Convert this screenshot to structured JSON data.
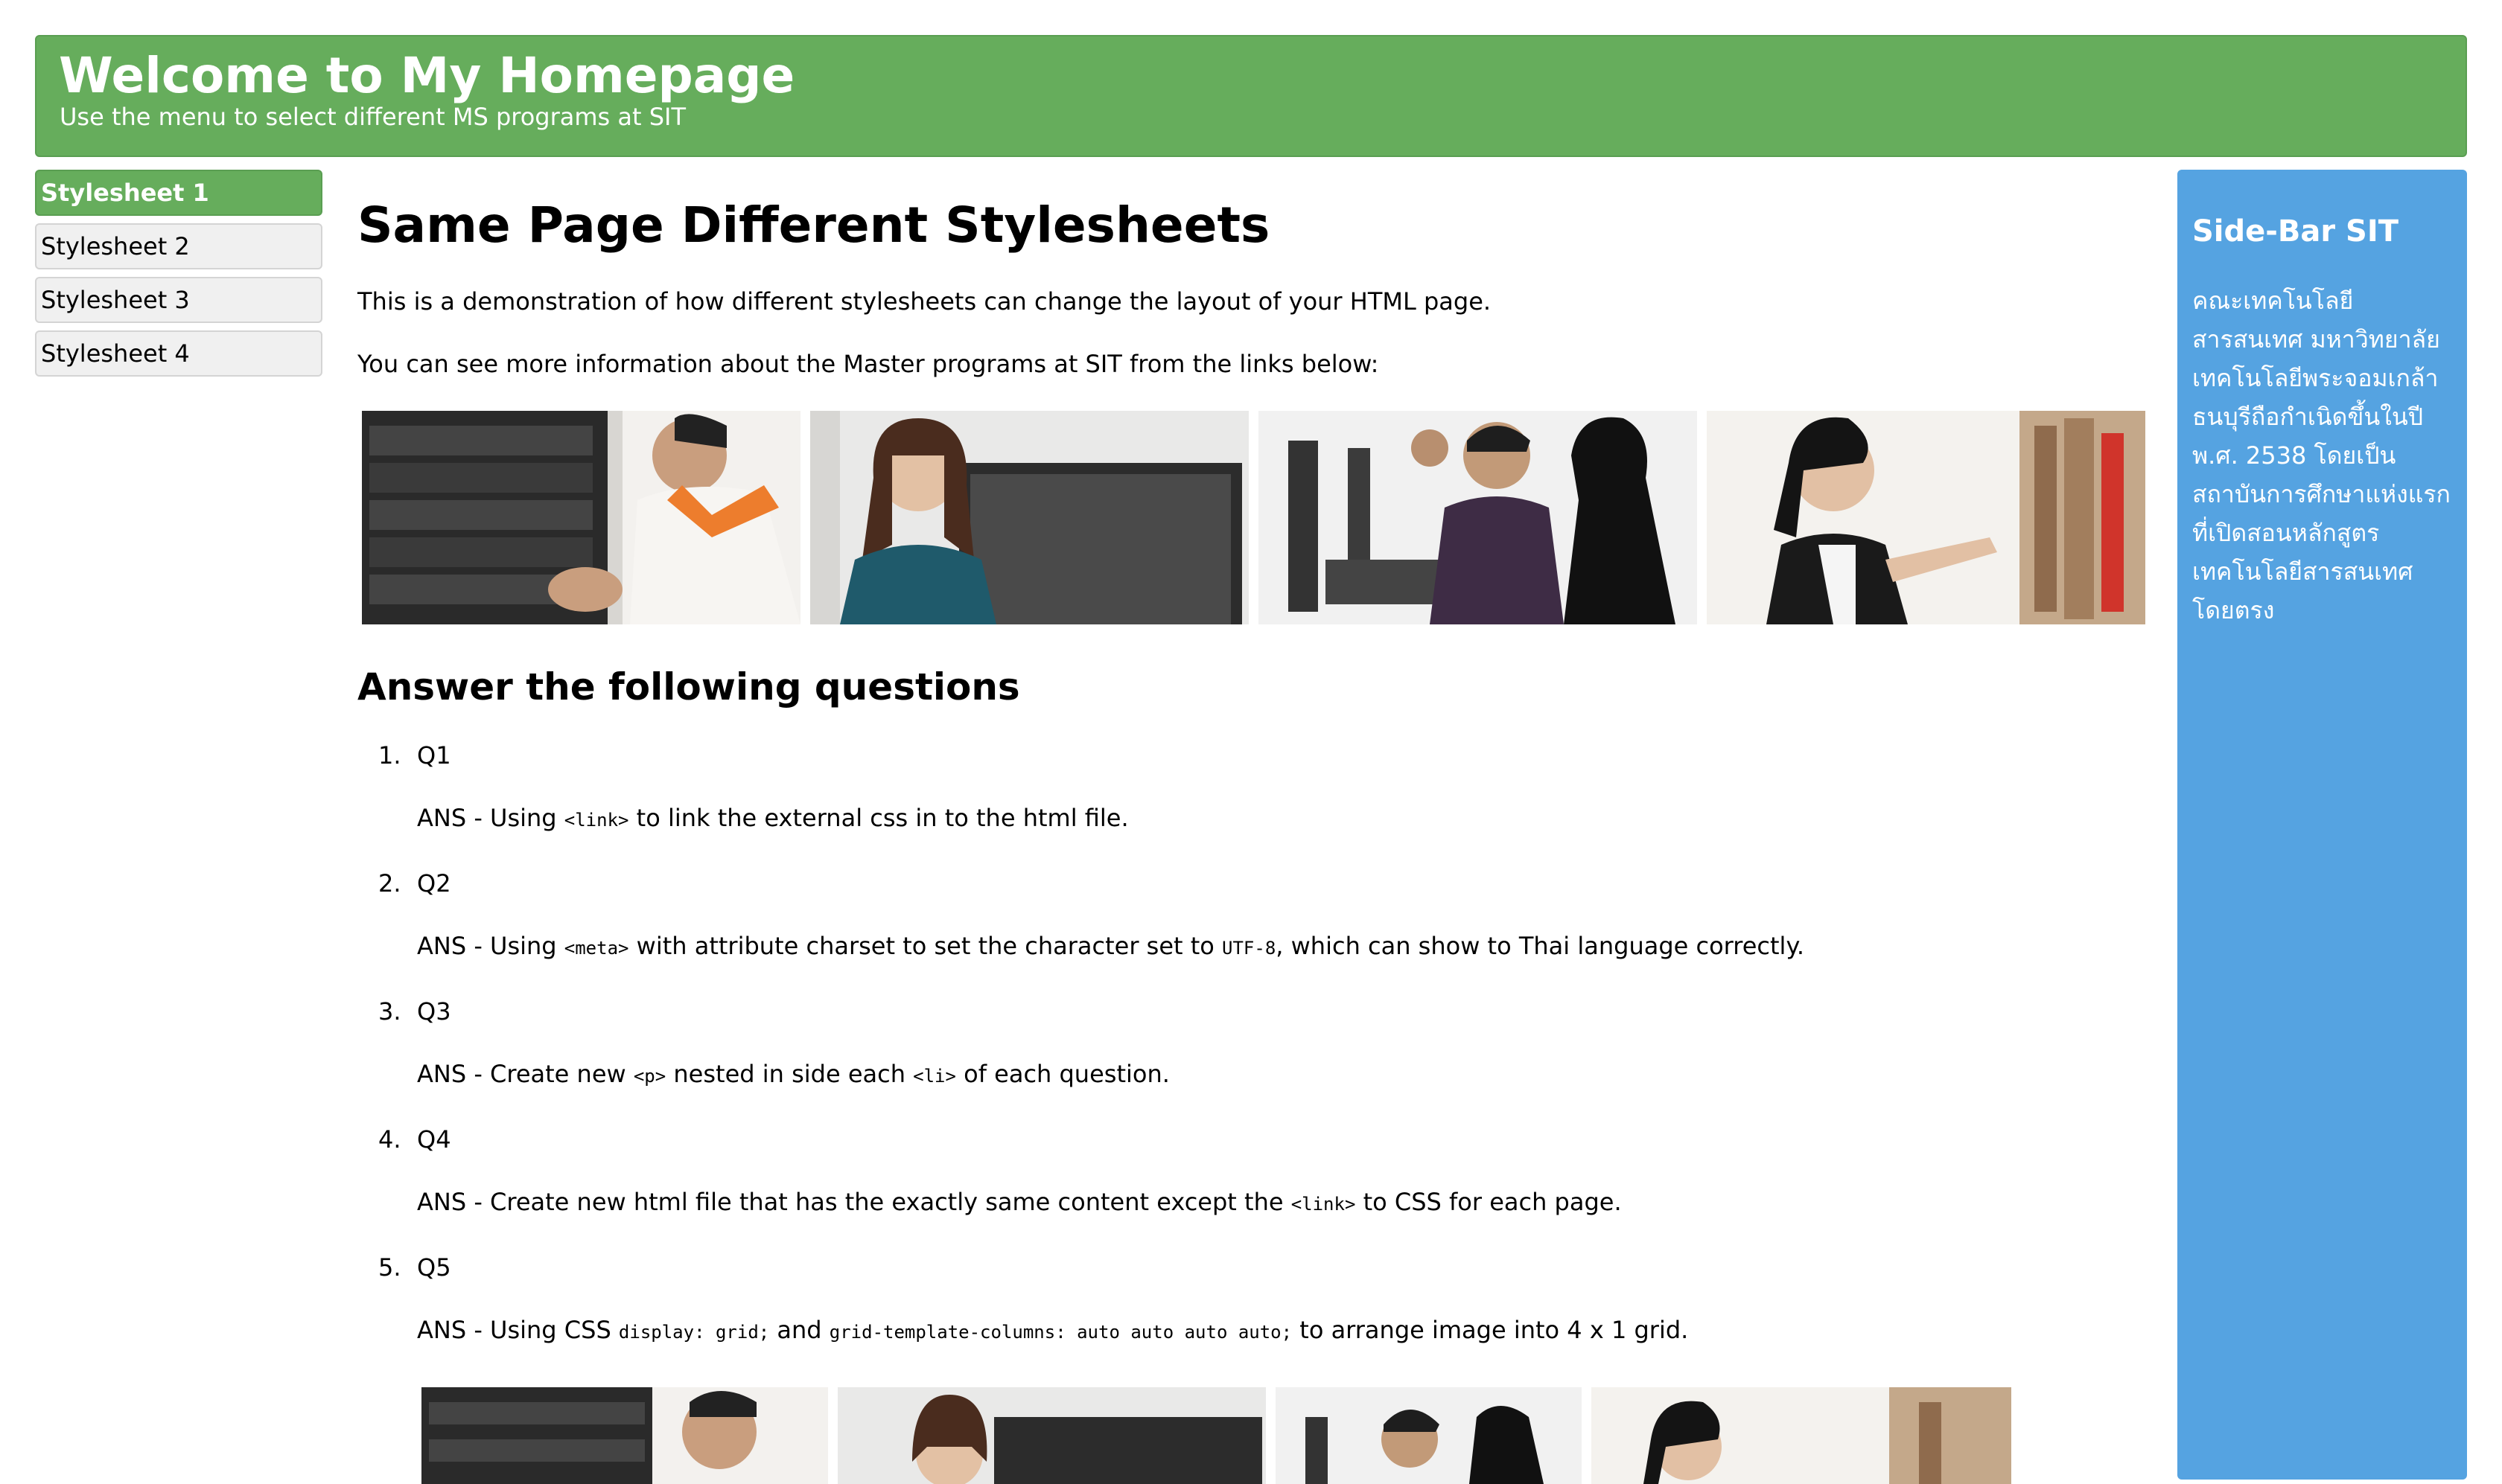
{
  "header": {
    "title": "Welcome to My Homepage",
    "subtitle": "Use the menu to select different MS programs at SIT"
  },
  "menu": {
    "items": [
      {
        "label": "Stylesheet 1"
      },
      {
        "label": "Stylesheet 2"
      },
      {
        "label": "Stylesheet 3"
      },
      {
        "label": "Stylesheet 4"
      }
    ]
  },
  "main": {
    "title": "Same Page Different Stylesheets",
    "intro": "This is a demonstration of how different stylesheets can change the layout of your HTML page.",
    "links_text": "You can see more information about the Master programs at SIT from the links below:",
    "questions_title": "Answer the following questions",
    "questions": [
      {
        "num": "1.",
        "label": "Q1",
        "ans_pre": "ANS - Using ",
        "code1": "<link>",
        "ans_mid": " to link the external css in to the html file.",
        "code2": "",
        "ans_post": ""
      },
      {
        "num": "2.",
        "label": "Q2",
        "ans_pre": "ANS - Using ",
        "code1": "<meta>",
        "ans_mid": " with attribute charset to set the character set to ",
        "code2": "UTF-8",
        "ans_post": ", which can show to Thai language correctly."
      },
      {
        "num": "3.",
        "label": "Q3",
        "ans_pre": "ANS - Create new ",
        "code1": "<p>",
        "ans_mid": " nested in side each ",
        "code2": "<li>",
        "ans_post": " of each question."
      },
      {
        "num": "4.",
        "label": "Q4",
        "ans_pre": "ANS - Create new html file that has the exactly same content except the ",
        "code1": "<link>",
        "ans_mid": " to CSS for each page.",
        "code2": "",
        "ans_post": ""
      },
      {
        "num": "5.",
        "label": "Q5",
        "ans_pre": "ANS - Using CSS ",
        "code1": "display: grid;",
        "ans_mid": " and ",
        "code2": "grid-template-columns: auto auto auto auto;",
        "ans_post": " to arrange image into 4 x 1 grid."
      }
    ]
  },
  "sidebar": {
    "title": "Side-Bar SIT",
    "text": "คณะเทคโนโลยีสารสนเทศ มหาวิทยาลัยเทคโนโลยีพระจอมเกล้าธนบุรีถือกำเนิดขึ้นในปี พ.ศ. 2538 โดยเป็นสถาบันการศึกษาแห่งแรกที่เปิดสอนหลักสูตรเทคโนโลยีสารสนเทศโดยตรง"
  },
  "photos": [
    "server-rack-photo",
    "woman-at-computer-photo",
    "computer-lab-photo",
    "woman-at-bookshelf-photo"
  ],
  "colors": {
    "header_bg": "#66ad5c",
    "sidebar_bg": "#55a3e1",
    "menu_bg": "#f0f0f0"
  }
}
